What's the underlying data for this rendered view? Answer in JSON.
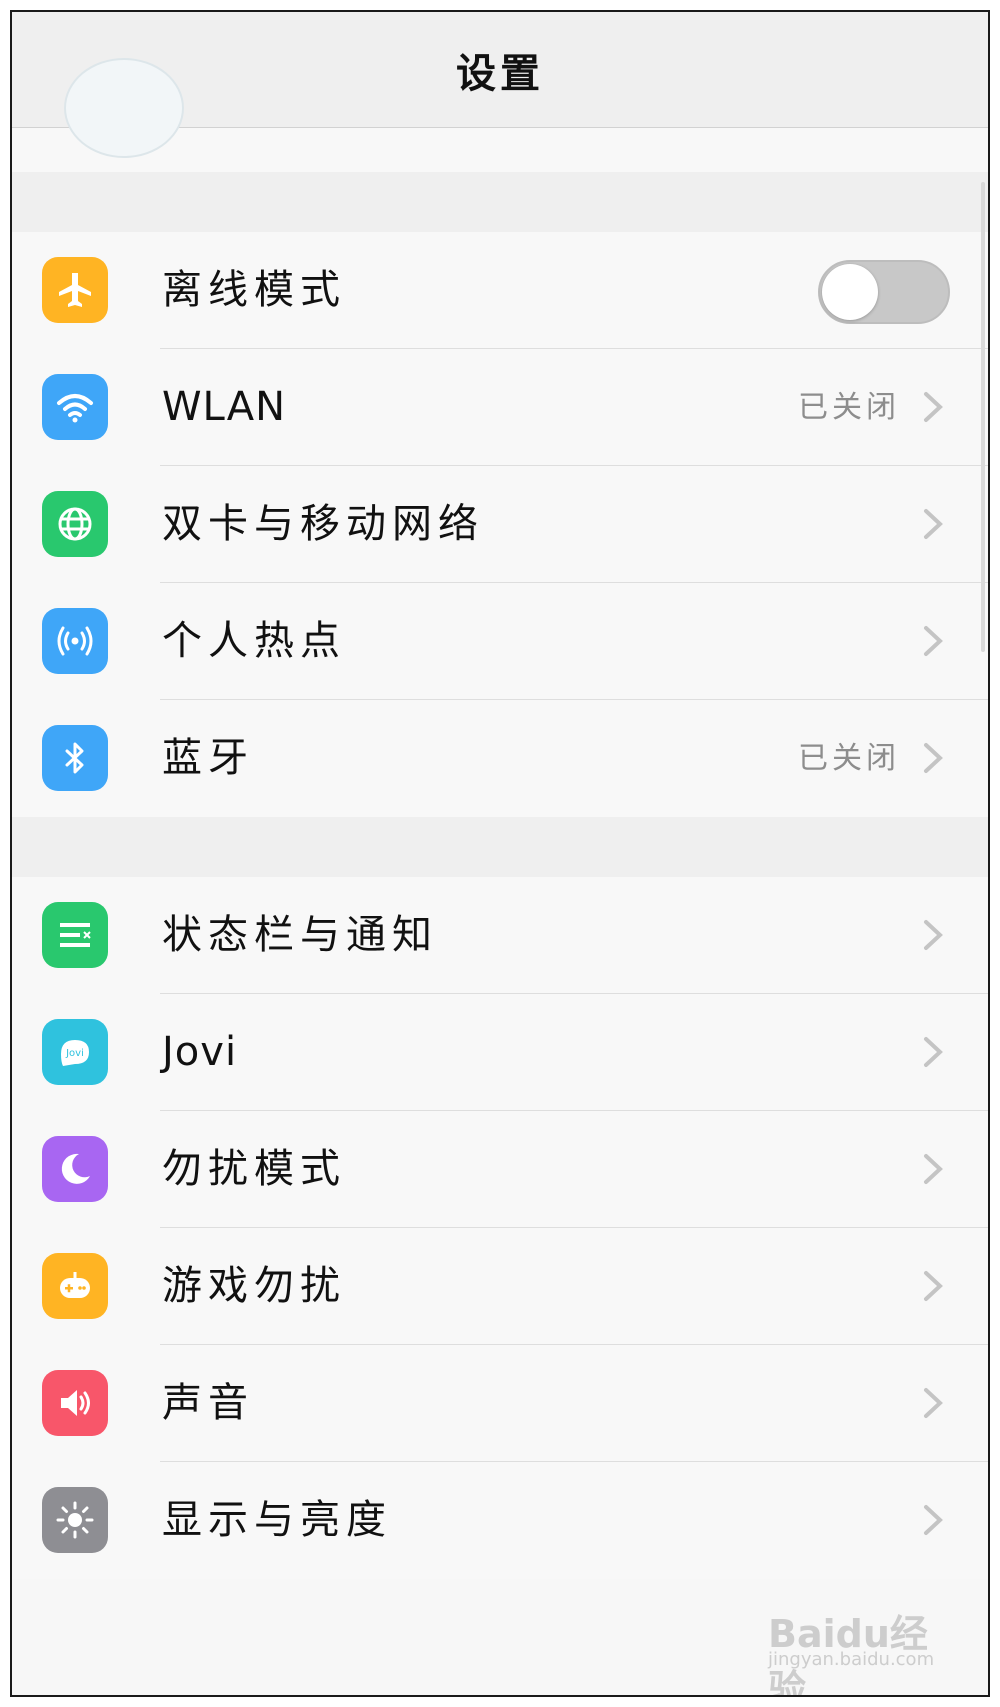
{
  "header": {
    "title": "设置"
  },
  "section1": [
    {
      "label": "离线模式",
      "icon": "airplane-icon",
      "color": "#FFB423",
      "toggle": {
        "on": false
      }
    },
    {
      "label": "WLAN",
      "icon": "wifi-icon",
      "color": "#3FA6F8",
      "status": "已关闭"
    },
    {
      "label": "双卡与移动网络",
      "icon": "globe-icon",
      "color": "#29C86E"
    },
    {
      "label": "个人热点",
      "icon": "hotspot-icon",
      "color": "#3FA6F8"
    },
    {
      "label": "蓝牙",
      "icon": "bluetooth-icon",
      "color": "#3FA6F8",
      "status": "已关闭"
    }
  ],
  "section2": [
    {
      "label": "状态栏与通知",
      "icon": "notification-bar-icon",
      "color": "#29C86E"
    },
    {
      "label": "Jovi",
      "icon": "jovi-icon",
      "color": "#2FC2DE",
      "icon_text": "Jovi"
    },
    {
      "label": "勿扰模式",
      "icon": "moon-icon",
      "color": "#A866F2"
    },
    {
      "label": "游戏勿扰",
      "icon": "gamepad-icon",
      "color": "#FFB423"
    },
    {
      "label": "声音",
      "icon": "speaker-icon",
      "color": "#F8566A"
    },
    {
      "label": "显示与亮度",
      "icon": "brightness-icon",
      "color": "#8E8E93"
    }
  ],
  "watermark": {
    "main": "Baidu经验",
    "sub": "jingyan.baidu.com"
  }
}
